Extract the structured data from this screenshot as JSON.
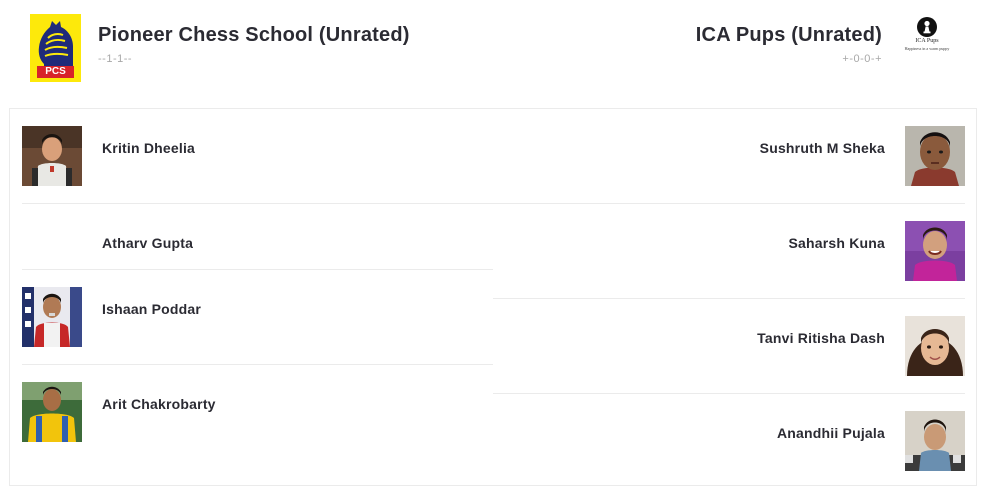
{
  "team_left": {
    "name": "Pioneer Chess School (Unrated)",
    "score": "--1-1--",
    "logo_text": "PCS"
  },
  "team_right": {
    "name": "ICA Pups (Unrated)",
    "score": "+-0-0-+",
    "logo_name": "ICA Pups",
    "logo_tagline": "Happiness in a warm puppy"
  },
  "players_left": [
    {
      "name": "Kritin Dheelia",
      "has_photo": true
    },
    {
      "name": "Atharv Gupta",
      "has_photo": false
    },
    {
      "name": "Ishaan Poddar",
      "has_photo": true
    },
    {
      "name": "Arit Chakrobarty",
      "has_photo": true
    }
  ],
  "players_right": [
    {
      "name": "Sushruth M Sheka",
      "has_photo": true
    },
    {
      "name": "Saharsh Kuna",
      "has_photo": true
    },
    {
      "name": "Tanvi Ritisha Dash",
      "has_photo": true
    },
    {
      "name": "Anandhii Pujala",
      "has_photo": true
    }
  ],
  "colors": {
    "pcs_yellow": "#fde90b",
    "pcs_navy": "#1f2a7a",
    "pcs_red": "#d8232a",
    "text": "#2b2b33",
    "muted": "#a8a8a8",
    "divider": "#ebebeb"
  },
  "icons": {
    "left_logo": "knight-logo-icon",
    "right_logo": "pawn-logo-icon"
  }
}
